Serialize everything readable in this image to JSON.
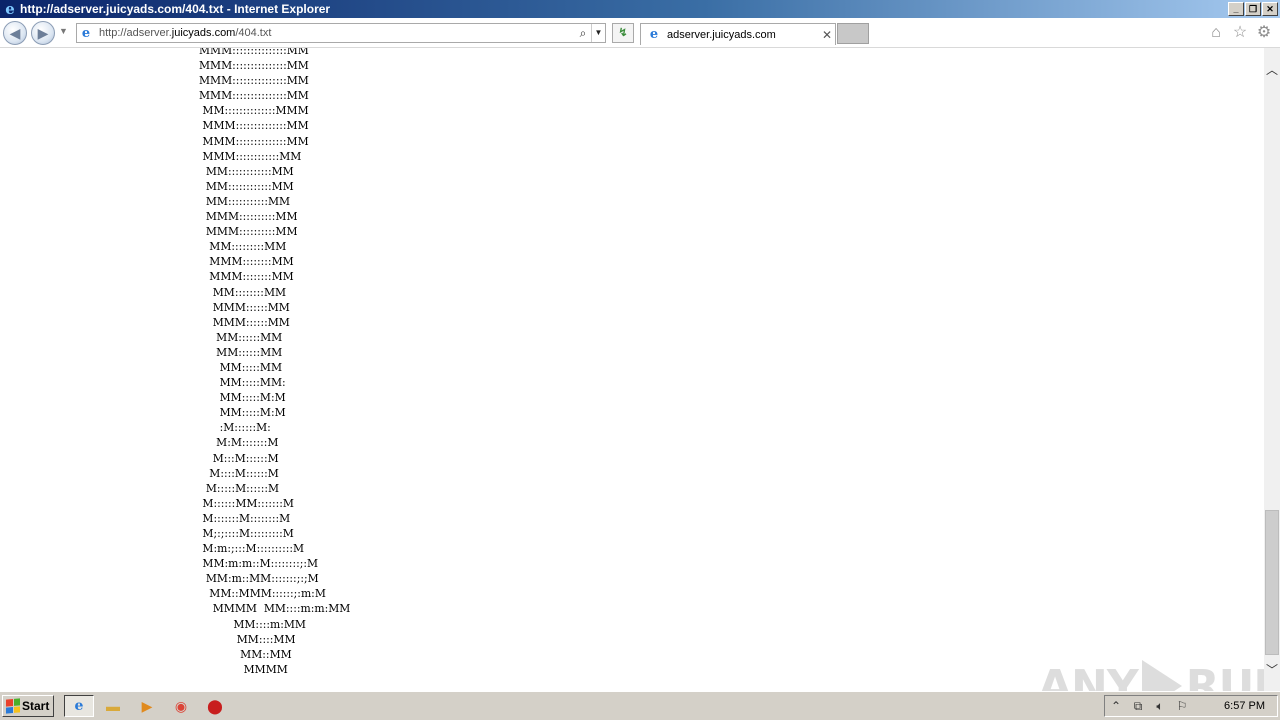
{
  "window": {
    "title": "http://adserver.juicyads.com/404.txt - Internet Explorer"
  },
  "address_bar": {
    "url_prefix": "http://adserver.",
    "url_domain": "juicyads.com",
    "url_suffix": "/404.txt"
  },
  "tab": {
    "label": "adserver.juicyads.com"
  },
  "ascii_art": [
    "MMM:::::::::::::::MM",
    "MMM:::::::::::::::MM",
    "MMM:::::::::::::::MM",
    "MMM:::::::::::::::MM",
    " MM::::::::::::::MMM",
    " MMM::::::::::::::MM",
    " MMM::::::::::::::MM",
    " MMM::::::::::::MM",
    "  MM::::::::::::MM",
    "  MM::::::::::::MM",
    "  MM:::::::::::MM",
    "  MMM::::::::::MM",
    "  MMM::::::::::MM",
    "   MM:::::::::MM",
    "   MMM::::::::MM",
    "   MMM::::::::MM",
    "    MM::::::::MM",
    "    MMM::::::MM",
    "    MMM::::::MM",
    "     MM::::::MM",
    "     MM::::::MM",
    "      MM:::::MM",
    "      MM:::::MM:",
    "      MM:::::M:M",
    "      MM:::::M:M",
    "      :M::::::M:",
    "     M:M:::::::M",
    "    M:::M::::::M",
    "   M::::M::::::M",
    "  M:::::M::::::M",
    " M::::::MM:::::::M",
    " M:::::::M::::::::M",
    " M;:;::::M:::::::::M",
    " M:m:;:::M::::::::::M",
    " MM:m:m::M::::::::;:M",
    "  MM:m::MM:::::::;:;M",
    "   MM::MMM::::::;:m:M",
    "    MMMM  MM::::m:m:MM",
    "          MM::::m:MM",
    "           MM::::MM",
    "            MM::MM",
    "             MMMM"
  ],
  "watermark": {
    "text_left": "ANY",
    "text_right": "RUN"
  },
  "taskbar": {
    "start_label": "Start",
    "clock": "6:57 PM"
  }
}
